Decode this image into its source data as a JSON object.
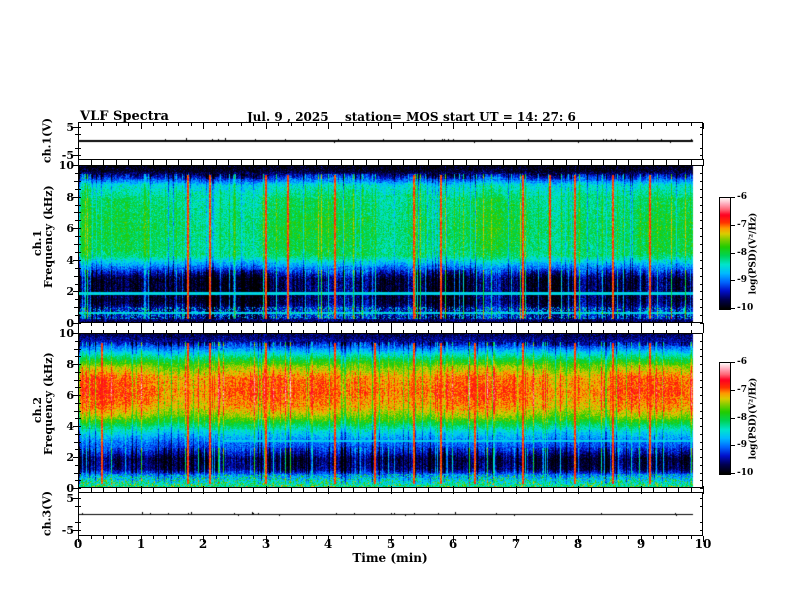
{
  "title": {
    "app": "VLF Spectra",
    "date": "Jul. 9 , 2025",
    "station": "station= MOS",
    "start_ut": "start UT =  14: 27: 6"
  },
  "xaxis": {
    "label": "Time (min)",
    "ticks": [
      0,
      1,
      2,
      3,
      4,
      5,
      6,
      7,
      8,
      9,
      10
    ],
    "range": [
      0,
      10
    ],
    "minor_step": 0.2,
    "data_end_min": 9.82
  },
  "panels": {
    "ch1_wave": {
      "ylabel": "ch.1(V)",
      "yticks": [
        5,
        -5
      ],
      "ylim": [
        -5,
        5
      ]
    },
    "ch1_spec": {
      "ylabel_line1": "ch.1",
      "ylabel_line2": "Frequency (kHz)",
      "yticks": [
        10,
        8,
        6,
        4,
        2,
        0
      ],
      "ylim": [
        0,
        10
      ]
    },
    "ch2_spec": {
      "ylabel_line1": "ch.2",
      "ylabel_line2": "Frequency (kHz)",
      "yticks": [
        10,
        8,
        6,
        4,
        2,
        0
      ],
      "ylim": [
        0,
        10
      ]
    },
    "ch3_wave": {
      "ylabel": "ch.3(V)",
      "yticks": [
        5,
        -5
      ],
      "ylim": [
        -5,
        5
      ]
    }
  },
  "colorbar": {
    "label": "log(PSD)(V²/Hz)",
    "ticks": [
      -6,
      -7,
      -8,
      -9,
      -10
    ],
    "range": [
      -10,
      -6
    ],
    "stops": [
      [
        0.0,
        "#000000"
      ],
      [
        0.08,
        "#000050"
      ],
      [
        0.16,
        "#0010cc"
      ],
      [
        0.24,
        "#0066ff"
      ],
      [
        0.32,
        "#00bbff"
      ],
      [
        0.4,
        "#00e6cc"
      ],
      [
        0.48,
        "#00d455"
      ],
      [
        0.56,
        "#22cc00"
      ],
      [
        0.63,
        "#88cc00"
      ],
      [
        0.68,
        "#ddcc00"
      ],
      [
        0.73,
        "#ff9900"
      ],
      [
        0.78,
        "#ff3300"
      ],
      [
        0.85,
        "#ff0022"
      ],
      [
        0.9,
        "#ff6677"
      ],
      [
        0.95,
        "#ffaabb"
      ],
      [
        1.0,
        "#fff5f5"
      ]
    ]
  },
  "chart_data": [
    {
      "type": "line",
      "panel": "ch1_waveform",
      "ylabel": "ch.1(V)",
      "ylim": [
        -5,
        5
      ],
      "x_range_min": [
        0,
        9.82
      ],
      "series": [
        {
          "name": "ch.1 voltage",
          "description": "flat trace at ~0 V for the whole record with tiny impulsive blips",
          "mean": 0,
          "peak_abs": 0.4
        }
      ],
      "seed": 11
    },
    {
      "type": "heatmap",
      "panel": "ch1_spectrogram",
      "ylabel": "Frequency (kHz)",
      "xlabel": "Time (min)",
      "x_range": [
        0,
        9.82
      ],
      "y_range": [
        0,
        10
      ],
      "z_label": "log(PSD)(V²/Hz)",
      "z_range": [
        -10,
        -6
      ],
      "profile_points": [
        [
          0,
          -9.9
        ],
        [
          0.15,
          -9.6
        ],
        [
          0.5,
          -9.35
        ],
        [
          0.9,
          -9.45
        ],
        [
          1.3,
          -9.75
        ],
        [
          2.8,
          -9.75
        ],
        [
          3.6,
          -8.9
        ],
        [
          4.3,
          -8.15
        ],
        [
          6.0,
          -8.05
        ],
        [
          8.0,
          -8.2
        ],
        [
          8.8,
          -8.5
        ],
        [
          9.3,
          -9.3
        ],
        [
          9.7,
          -9.85
        ],
        [
          10,
          -9.95
        ]
      ],
      "speckle_band": [
        0.2,
        1.0
      ],
      "horizontal_lines": [
        {
          "f_khz": 1.85,
          "t0": 0,
          "t1": 9.82,
          "psd": -8.55
        },
        {
          "f_khz": 0.62,
          "t0": 0,
          "t1": 9.82,
          "psd": -8.55
        }
      ],
      "transient_lines_min": [
        1.72,
        2.08,
        2.98,
        3.32,
        4.08,
        5.35,
        5.78,
        7.08,
        7.52,
        7.92,
        8.52,
        9.12
      ],
      "noise_sigma": 1.0,
      "seed": 101
    },
    {
      "type": "heatmap",
      "panel": "ch2_spectrogram",
      "ylabel": "Frequency (kHz)",
      "xlabel": "Time (min)",
      "x_range": [
        0,
        9.82
      ],
      "y_range": [
        0,
        10
      ],
      "z_label": "log(PSD)(V²/Hz)",
      "z_range": [
        -10,
        -6
      ],
      "profile_points": [
        [
          0,
          -8.2
        ],
        [
          0.3,
          -8.5
        ],
        [
          0.8,
          -8.95
        ],
        [
          1.2,
          -9.6
        ],
        [
          1.9,
          -9.7
        ],
        [
          2.4,
          -9.25
        ],
        [
          3.0,
          -8.95
        ],
        [
          3.6,
          -8.55
        ],
        [
          4.1,
          -8.05
        ],
        [
          4.6,
          -7.55
        ],
        [
          5.2,
          -7.15
        ],
        [
          6.2,
          -6.95
        ],
        [
          7.2,
          -7.05
        ],
        [
          7.9,
          -7.5
        ],
        [
          8.5,
          -8.15
        ],
        [
          9.0,
          -8.8
        ],
        [
          9.5,
          -9.45
        ],
        [
          10,
          -9.7
        ]
      ],
      "speckle_band": [
        0.05,
        0.9
      ],
      "horizontal_lines": [
        {
          "f_khz": 3.05,
          "t0": 2.3,
          "t1": 9.82,
          "psd": -8.6
        }
      ],
      "transient_lines_min": [
        0.35,
        1.72,
        2.08,
        2.98,
        4.08,
        4.72,
        5.35,
        5.78,
        6.32,
        7.08,
        7.92,
        8.52,
        9.12
      ],
      "noise_sigma": 0.9,
      "seed": 202
    },
    {
      "type": "line",
      "panel": "ch3_waveform",
      "ylabel": "ch.3(V)",
      "ylim": [
        -5,
        5
      ],
      "x_range_min": [
        0,
        9.82
      ],
      "series": [
        {
          "name": "ch.3 voltage",
          "description": "flat trace at ~0 V for the whole record with tiny impulsive blips",
          "mean": 0,
          "peak_abs": 0.3
        }
      ],
      "seed": 33
    }
  ]
}
